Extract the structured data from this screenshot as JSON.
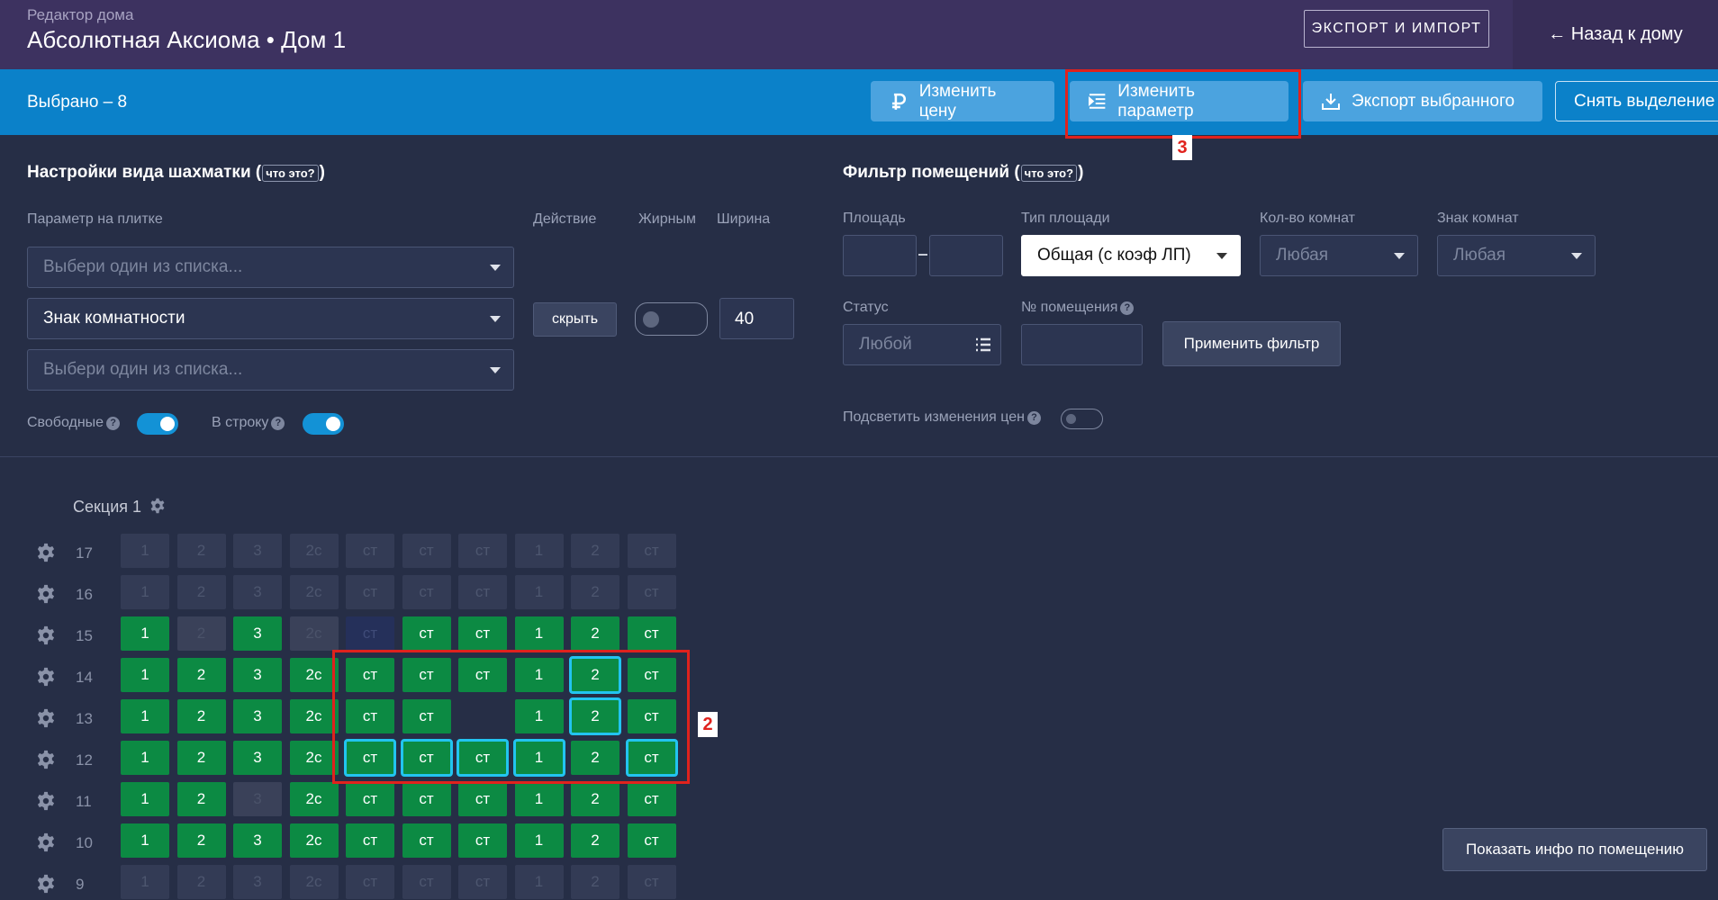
{
  "header": {
    "subtitle": "Редактор дома",
    "title": "Абсолютная Аксиома • Дом 1",
    "export_import": "ЭКСПОРТ И ИМПОРТ",
    "back": "← Назад к дому"
  },
  "selbar": {
    "count": "Выбрано – 8",
    "change_price": "Изменить цену",
    "change_param": "Изменить параметр",
    "export_selected": "Экспорт выбранного",
    "clear_selection": "Снять выделение"
  },
  "view": {
    "heading": "Настройки вида шахматки",
    "what": "что это?",
    "param_label": "Параметр на плитке",
    "action_label": "Действие",
    "bold_label": "Жирным",
    "width_label": "Ширина",
    "select1": "Выбери один из списка...",
    "select2": "Знак комнатности",
    "select3": "Выбери один из списка...",
    "hide": "скрыть",
    "width_value": "40",
    "free_label": "Свободные",
    "inline_label": "В строку"
  },
  "filter": {
    "heading": "Фильтр помещений",
    "what": "что это?",
    "area_label": "Площадь",
    "area_type_label": "Тип площади",
    "area_type_value": "Общая (с коэф ЛП)",
    "rooms_label": "Кол-во комнат",
    "rooms_value": "Любая",
    "rooms_sign_label": "Знак комнат",
    "rooms_sign_value": "Любая",
    "status_label": "Статус",
    "status_value": "Любой",
    "number_label": "№ помещения",
    "apply": "Применить фильтр",
    "highlight_label": "Подсветить изменения цен"
  },
  "section": {
    "title": "Секция 1"
  },
  "grid": {
    "labels": [
      "1",
      "2",
      "3",
      "2с",
      "ст",
      "ст",
      "ст",
      "1",
      "2",
      "ст"
    ],
    "floors": [
      {
        "floor": "17",
        "states": [
          "d",
          "d",
          "d",
          "d",
          "d",
          "d",
          "d",
          "d",
          "d",
          "d"
        ]
      },
      {
        "floor": "16",
        "states": [
          "d",
          "d",
          "d",
          "d",
          "d",
          "d",
          "d",
          "d",
          "d",
          "d"
        ]
      },
      {
        "floor": "15",
        "states": [
          "g",
          "s",
          "g",
          "s",
          "b",
          "g",
          "g",
          "g",
          "g",
          "g"
        ]
      },
      {
        "floor": "14",
        "states": [
          "g",
          "g",
          "g",
          "g",
          "g",
          "g",
          "g",
          "g",
          "gs",
          "g"
        ]
      },
      {
        "floor": "13",
        "states": [
          "g",
          "g",
          "g",
          "g",
          "g",
          "g",
          "e",
          "g",
          "gs",
          "g"
        ]
      },
      {
        "floor": "12",
        "states": [
          "g",
          "g",
          "g",
          "g",
          "gs",
          "gs",
          "gs",
          "gs",
          "g",
          "gs"
        ]
      },
      {
        "floor": "11",
        "states": [
          "g",
          "g",
          "s",
          "g",
          "g",
          "g",
          "g",
          "g",
          "g",
          "g"
        ]
      },
      {
        "floor": "10",
        "states": [
          "g",
          "g",
          "g",
          "g",
          "g",
          "g",
          "g",
          "g",
          "g",
          "g"
        ]
      },
      {
        "floor": "9",
        "states": [
          "d",
          "d",
          "d",
          "d",
          "d",
          "d",
          "d",
          "d",
          "d",
          "d"
        ]
      }
    ]
  },
  "show_info": "Показать инфо по помещению",
  "annotations": {
    "marker2": "2",
    "marker3": "3"
  }
}
